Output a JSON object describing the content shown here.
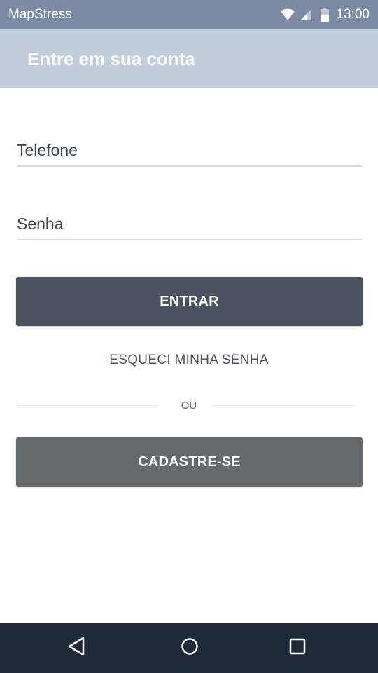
{
  "status_bar": {
    "app_name": "MapStress",
    "time": "13:00",
    "icons": [
      "wifi-icon",
      "signal-icon",
      "battery-icon"
    ]
  },
  "app_bar": {
    "title": "Entre em sua conta"
  },
  "form": {
    "phone_placeholder": "Telefone",
    "password_placeholder": "Senha",
    "login_label": "ENTRAR",
    "forgot_label": "ESQUECI MINHA SENHA",
    "divider_label": "OU",
    "signup_label": "CADASTRE-SE"
  },
  "nav_bar": {
    "icons": [
      "back-icon",
      "home-icon",
      "recent-apps-icon"
    ]
  },
  "colors": {
    "status_bar": "#7b8ba3",
    "app_bar": "#c1ccdc",
    "login_button": "#4b5360",
    "signup_button": "#66696c",
    "nav_bar": "#1e2a3a"
  }
}
